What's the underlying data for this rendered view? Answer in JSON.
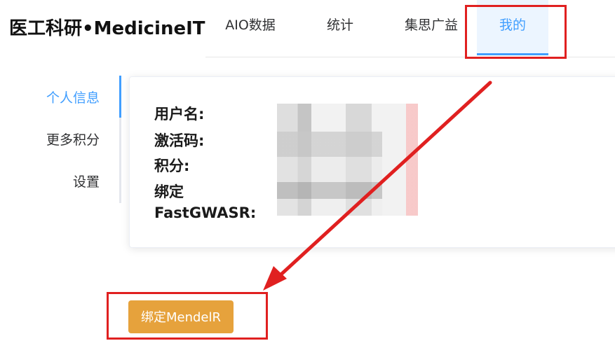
{
  "brand": {
    "title": "医工科研•MedicineIT"
  },
  "topnav": {
    "tabs": [
      {
        "label": "AIO数据"
      },
      {
        "label": "统计"
      },
      {
        "label": "集思广益"
      },
      {
        "label": "我的",
        "active": true
      }
    ]
  },
  "sidenav": {
    "items": [
      {
        "label": "个人信息",
        "active": true
      },
      {
        "label": "更多积分"
      },
      {
        "label": "设置"
      }
    ]
  },
  "profile": {
    "username_label": "用户名:",
    "activation_label": "激活码:",
    "points_label": "积分:",
    "bind_label_line1": "绑定",
    "bind_label_line2": "FastGWASR:"
  },
  "actions": {
    "bind_mendelr_label": "绑定MendelR"
  },
  "colors": {
    "accent": "#409eff",
    "warning_button": "#e6a23c",
    "annotation": "#e02020"
  }
}
